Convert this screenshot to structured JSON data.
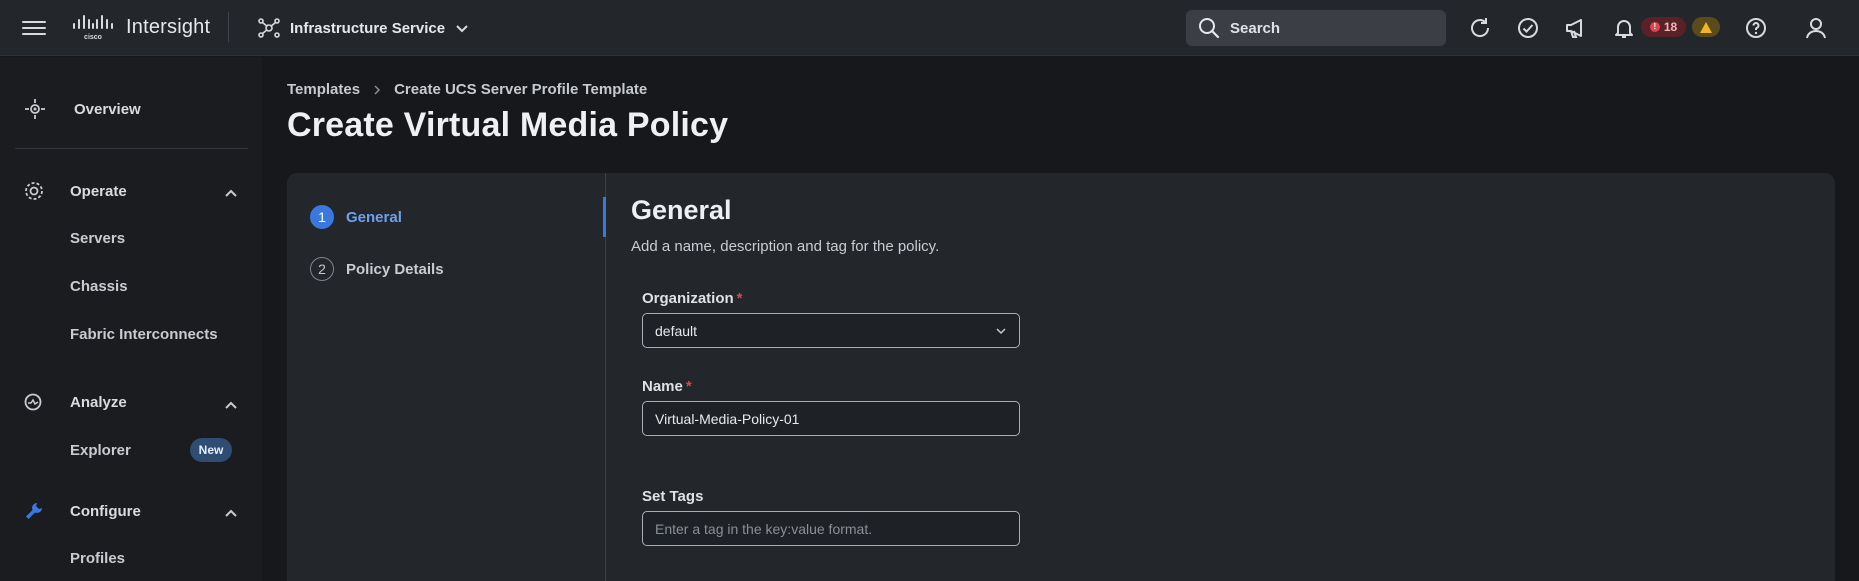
{
  "header": {
    "brand": "Intersight",
    "service": "Infrastructure Service",
    "search_label": "Search",
    "critical_count": "18",
    "icons": [
      "menu-icon",
      "cisco-logo",
      "service-icon",
      "chevron-down-icon",
      "search-icon",
      "refresh-icon",
      "task-check-icon",
      "announcement-icon",
      "bell-icon",
      "warning-icon",
      "help-icon",
      "user-icon"
    ]
  },
  "sidebar": {
    "overview": "Overview",
    "operate": {
      "label": "Operate",
      "items": [
        "Servers",
        "Chassis",
        "Fabric Interconnects"
      ]
    },
    "analyze": {
      "label": "Analyze",
      "items": [
        "Explorer"
      ],
      "new_badge": "New"
    },
    "configure": {
      "label": "Configure",
      "items": [
        "Profiles"
      ]
    },
    "accent_color": "#3a78e0"
  },
  "breadcrumb": [
    "Templates",
    "Create UCS Server Profile Template"
  ],
  "page_title": "Create Virtual Media Policy",
  "steps": [
    {
      "num": "1",
      "label": "General",
      "state": "active"
    },
    {
      "num": "2",
      "label": "Policy Details",
      "state": "inactive"
    }
  ],
  "general": {
    "title": "General",
    "subtitle": "Add a name, description and tag for the policy.",
    "organization_label": "Organization",
    "organization_value": "default",
    "name_label": "Name",
    "name_value": "Virtual-Media-Policy-01",
    "tags_label": "Set Tags",
    "tags_placeholder": "Enter a tag in the key:value format."
  }
}
